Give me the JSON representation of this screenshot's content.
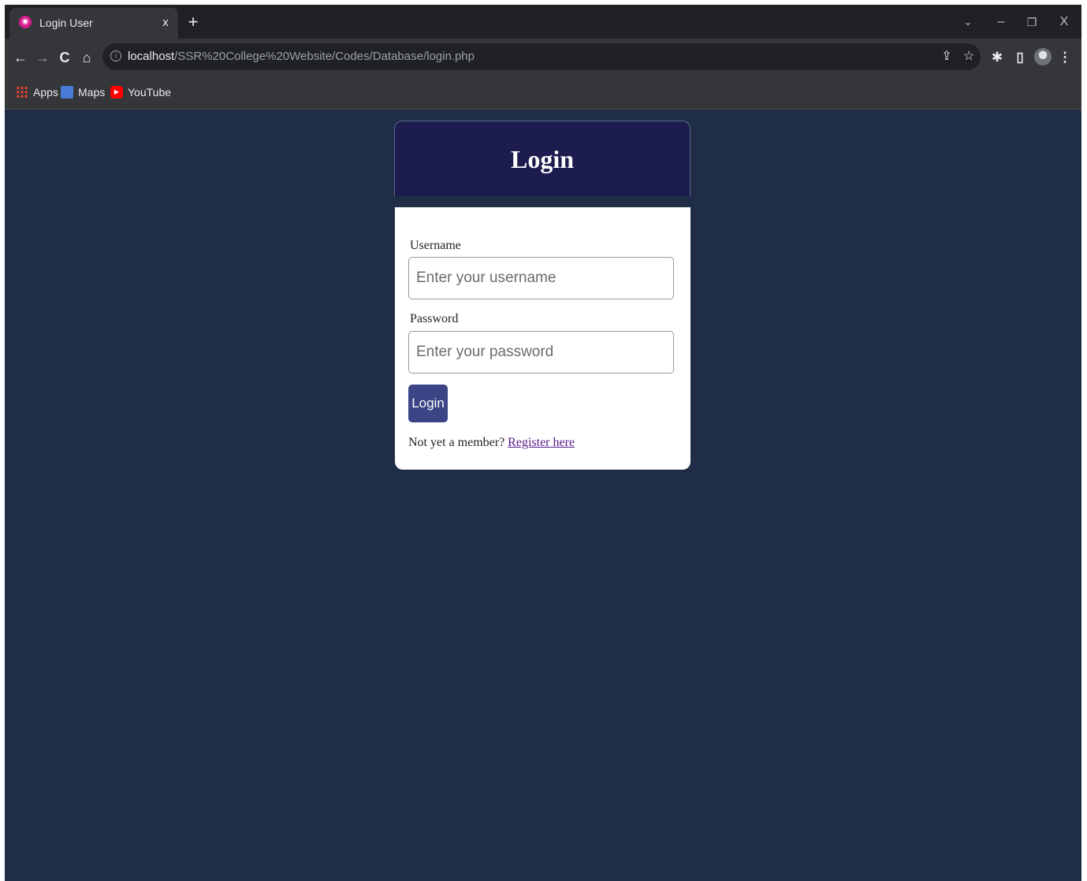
{
  "browser": {
    "tab": {
      "title": "Login User",
      "close_glyph": "x",
      "favicon": "app-favicon-icon"
    },
    "new_tab_glyph": "+",
    "window_controls": {
      "tab_search": "⌄",
      "minimize": "–",
      "restore": "❐",
      "close": "X"
    },
    "nav": {
      "back": "←",
      "forward": "→",
      "reload": "C",
      "home": "⌂"
    },
    "address": {
      "info_glyph": "i",
      "host": "localhost",
      "path": "/SSR%20College%20Website/Codes/Database/login.php"
    },
    "toolbar_icons": {
      "share": "⇪",
      "bookmark_star": "☆",
      "extensions": "✱",
      "side_panel": "▯",
      "menu": "⋮"
    },
    "bookmarks": [
      {
        "label": "Apps",
        "icon": "apps-grid-icon"
      },
      {
        "label": "Maps",
        "icon": "maps-icon"
      },
      {
        "label": "YouTube",
        "icon": "youtube-icon"
      }
    ],
    "youtube_play_glyph": "▶"
  },
  "page": {
    "background": "#1f2d47",
    "header_color": "#1c1d4e",
    "title": "Login",
    "username": {
      "label": "Username",
      "placeholder": "Enter your username",
      "value": ""
    },
    "password": {
      "label": "Password",
      "placeholder": "Enter your password",
      "value": ""
    },
    "submit_label": "Login",
    "button_color": "#3b4586",
    "register_prompt": "Not yet a member? ",
    "register_link": "Register here"
  }
}
